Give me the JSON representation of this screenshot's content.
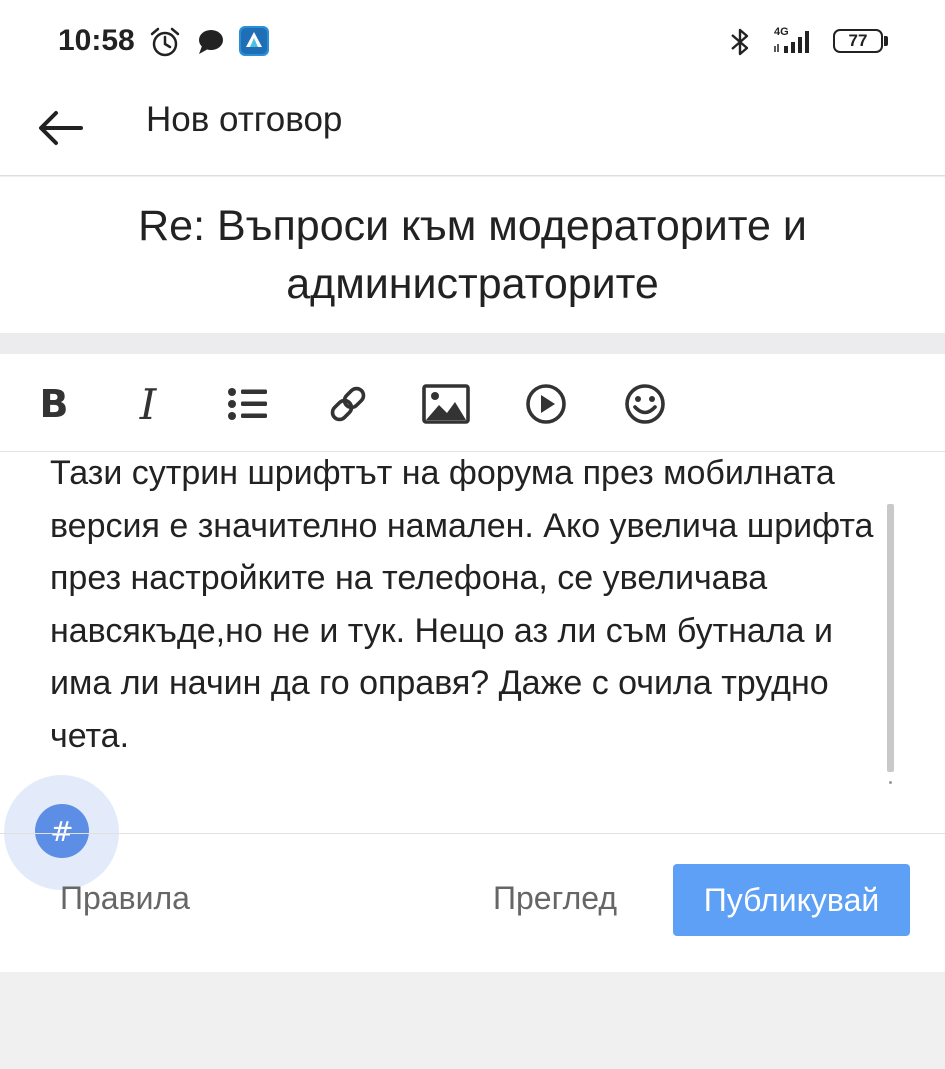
{
  "status_bar": {
    "time": "10:58",
    "icons": [
      "alarm-icon",
      "chat-bubble-icon",
      "app-icon",
      "bluetooth-icon",
      "signal-4g-icon",
      "battery-icon"
    ],
    "network": "4G",
    "battery": "77"
  },
  "app_bar": {
    "title": "Нов отговор",
    "back_icon": "arrow-left-icon"
  },
  "topic": {
    "title": "Re: Въпроси към модераторите и администраторите"
  },
  "toolbar": {
    "tools": [
      "bold",
      "italic",
      "bulleted-list",
      "link",
      "image",
      "video",
      "emoji"
    ],
    "bold_label": "B",
    "italic_label": "I"
  },
  "editor": {
    "text": "Тази сутрин шрифтът на форума през мобилната версия е значително намален. Ако увелича шрифта през настройките на телефона, се увеличава навсякъде,но не и тук. Нещо аз ли съм бутнала и има ли начин да го оправя? Даже с очила трудно чета."
  },
  "hashtag": {
    "label": "#"
  },
  "footer": {
    "rules_label": "Правила",
    "preview_label": "Преглед",
    "publish_label": "Публикувай"
  },
  "colors": {
    "accent": "#5ea0f5",
    "hashtag": "#5b8ee4",
    "text": "#222222",
    "muted": "#666666"
  }
}
